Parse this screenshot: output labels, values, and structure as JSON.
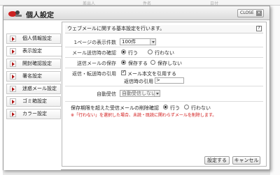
{
  "background": {
    "columns": [
      "差出人",
      "件名",
      "日付"
    ]
  },
  "dialog": {
    "title": "個人設定",
    "close_label": "CLOSE",
    "close_icon": "close-icon"
  },
  "sidebar": {
    "items": [
      {
        "label": "個人情報設定",
        "active": false
      },
      {
        "label": "表示設定",
        "active": true
      },
      {
        "label": "開封確認設定",
        "active": false
      },
      {
        "label": "署名設定",
        "active": false
      },
      {
        "label": "迷惑メール設定",
        "active": false
      },
      {
        "label": "ゴミ箱設定",
        "active": false
      },
      {
        "label": "カラー設定",
        "active": false
      }
    ]
  },
  "panel": {
    "heading": "ウェブメールに関する基本設定を行います。",
    "help_icon": "?",
    "page_size": {
      "label": "1ページの表示件数",
      "value": "100件"
    },
    "send_confirm": {
      "label": "メール送信時の確認",
      "options": [
        "行う",
        "行わない"
      ],
      "selected": "行う"
    },
    "save_sent": {
      "label": "送信メールの保存",
      "options": [
        "保存する",
        "保存しない"
      ],
      "selected": "保存する"
    },
    "quote": {
      "label": "返信・転送時の引用",
      "checkbox_label": "メール本文を引用する",
      "checked": true,
      "quote_mark_label": "返信時の引用",
      "quote_mark_value": ">"
    },
    "auto_receive": {
      "label": "自動受信",
      "value": "自動受信しない"
    },
    "delete_confirm": {
      "label": "保存期限を超えた受信メールの削除確認",
      "options": [
        "行う",
        "行わない"
      ],
      "selected": "行う",
      "note": "※「行わない」を選択した場合、未読・既読に関わらずメールを削除します。"
    }
  },
  "footer": {
    "save_label": "設定する",
    "cancel_label": "キャンセル"
  },
  "colors": {
    "accent": "#b01818",
    "note": "#d01010"
  }
}
